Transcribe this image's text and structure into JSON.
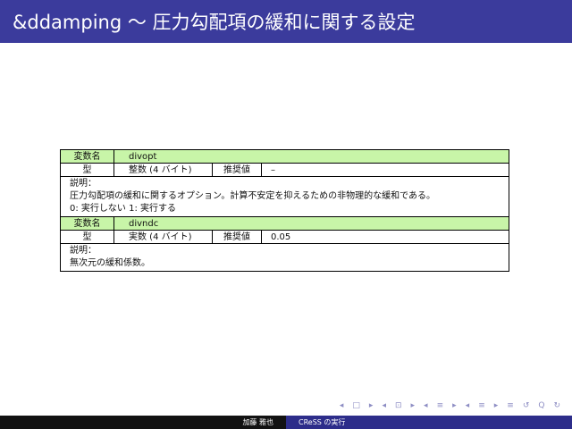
{
  "slide": {
    "title": "&ddamping ～ 圧力勾配項の緩和に関する設定"
  },
  "params": [
    {
      "label_name": "変数名",
      "name": "divopt",
      "label_type": "型",
      "type": "整数 (4 バイト)",
      "label_default": "推奨値",
      "default": "–",
      "label_desc": "説明：",
      "desc_lines": [
        "圧力勾配項の緩和に関するオプション。計算不安定を抑えるための非物理的な緩和である。",
        "0: 実行しない 1: 実行する"
      ]
    },
    {
      "label_name": "変数名",
      "name": "divndc",
      "label_type": "型",
      "type": "実数 (4 バイト)",
      "label_default": "推奨値",
      "default": "0.05",
      "label_desc": "説明：",
      "desc_lines": [
        "無次元の緩和係数。"
      ]
    }
  ],
  "footer": {
    "author": "加藤 雅也",
    "section": "CReSS の実行"
  },
  "nav": {
    "icons": [
      "◂",
      "□",
      "▸",
      "◂",
      "⊡",
      "▸",
      "◂",
      "≡",
      "▸",
      "◂",
      "≡",
      "▸",
      "≡",
      "↺",
      "Q",
      "↻"
    ]
  },
  "colors": {
    "title_bg": "#3b3b9c",
    "row_highlight": "#c8f5a8",
    "footer_left": "#121212",
    "footer_right": "#2d2d8a"
  }
}
